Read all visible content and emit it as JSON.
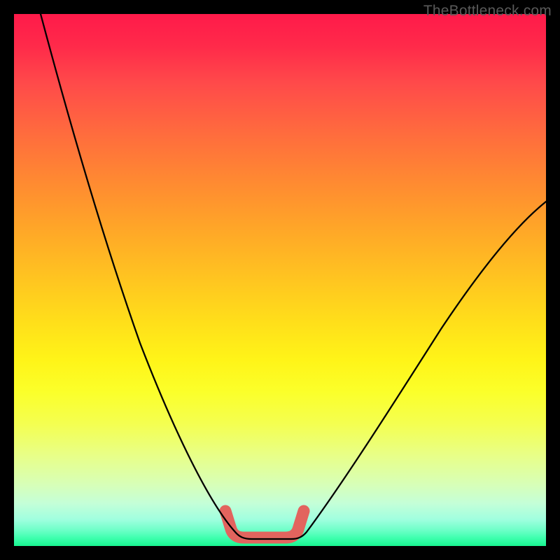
{
  "watermark": "TheBottleneck.com",
  "chart_data": {
    "type": "line",
    "title": "",
    "xlabel": "",
    "ylabel": "",
    "xlim": [
      0,
      100
    ],
    "ylim": [
      0,
      100
    ],
    "series": [
      {
        "name": "bottleneck-curve-left",
        "x": [
          5,
          8,
          12,
          16,
          20,
          24,
          28,
          32,
          36,
          39,
          41.5
        ],
        "y": [
          100,
          92,
          80,
          68,
          56,
          44,
          33,
          22,
          12,
          5,
          2
        ]
      },
      {
        "name": "optimal-trough",
        "x": [
          41.5,
          44,
          48,
          51,
          53.5
        ],
        "y": [
          2,
          1,
          1,
          1,
          2
        ]
      },
      {
        "name": "bottleneck-curve-right",
        "x": [
          53.5,
          57,
          62,
          68,
          74,
          80,
          86,
          92,
          98,
          100
        ],
        "y": [
          2,
          6,
          14,
          23,
          32,
          40,
          48,
          55,
          62,
          64
        ]
      }
    ],
    "marker": {
      "name": "optimal-range",
      "x_start": 40,
      "x_end": 54,
      "y": 2
    },
    "background_gradient": {
      "top": "#ff1a4a",
      "middle": "#ffe418",
      "bottom": "#18f590"
    }
  }
}
